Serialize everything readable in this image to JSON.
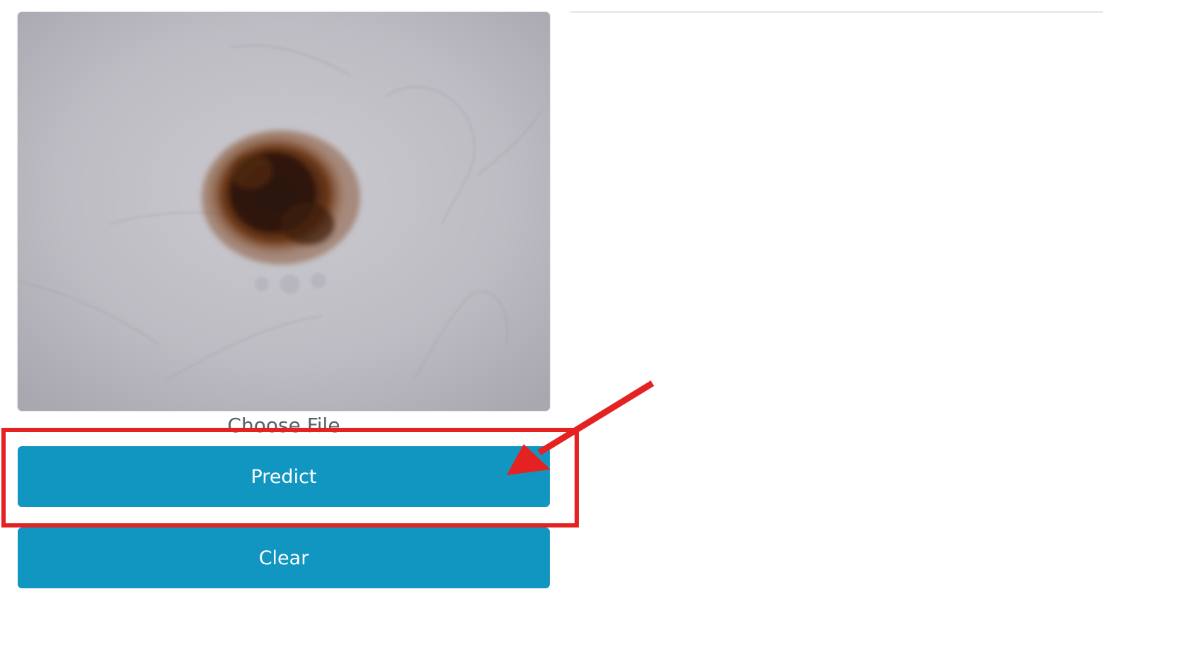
{
  "image_preview": {
    "alt": "Uploaded skin lesion image"
  },
  "file_input": {
    "label": "Choose File"
  },
  "buttons": {
    "predict_label": "Predict",
    "clear_label": "Clear"
  },
  "colors": {
    "button_bg": "#1196c1",
    "button_text": "#ffffff",
    "annotation": "#e52222",
    "label_text": "#54616b"
  }
}
